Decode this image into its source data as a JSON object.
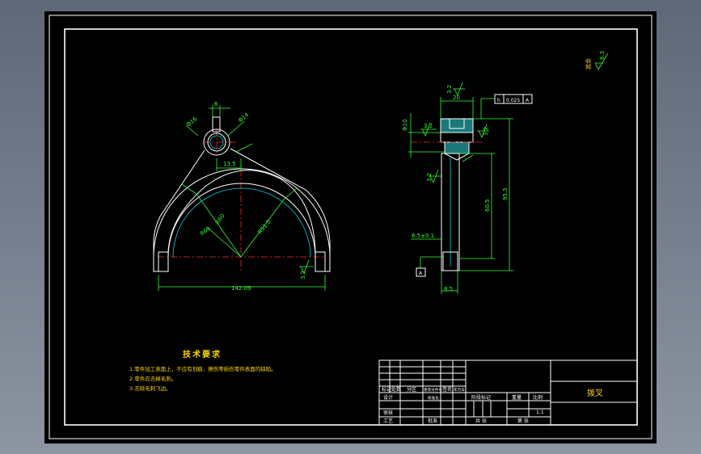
{
  "dims": {
    "top_width": "6",
    "fork_dia_small": "Φ16",
    "fork_dia_bore": "Φ14",
    "pin_offset": "13.5",
    "radius_r60": "R60",
    "radius_r66": "R66",
    "radius_r51": "R51.5",
    "span_width": "142.09",
    "tol_right": "3.2",
    "side_width": "20",
    "side_bore": "Φ10",
    "side_dia_left": "3.2",
    "side_surface": "3.2",
    "side_len": "60.5",
    "side_len_total": "95.5",
    "side_thick": "6.5±0.1",
    "side_bottom": "8.5",
    "datum": "A",
    "ra_right": "3.2"
  },
  "roughness_note": {
    "label": "其余",
    "value": "6.3"
  },
  "geometric_tolerance": {
    "symbol": "h",
    "value": "0.025",
    "datum": "A"
  },
  "tech_requirements": {
    "title": "技术要求",
    "items": [
      "1.零件加工表面上，不应有划痕、擦伤等损伤零件表面的缺陷。",
      "2.零件应去掉毛刺。",
      "3.去除毛刺飞边。"
    ]
  },
  "title_block": {
    "part_name": "拨叉",
    "scale": "1:1",
    "labels": {
      "mark": "标记",
      "count": "处数",
      "zone": "分区",
      "change_doc": "更改文件号",
      "sign": "签名",
      "date": "年月日",
      "design": "设计",
      "standardize": "标准化",
      "stage_mark": "阶段标记",
      "weight": "重量",
      "scale_label": "比例",
      "review": "审核",
      "process": "工艺",
      "approve": "批准",
      "sheets_total": "共 张",
      "sheet_no": "第 张"
    }
  }
}
